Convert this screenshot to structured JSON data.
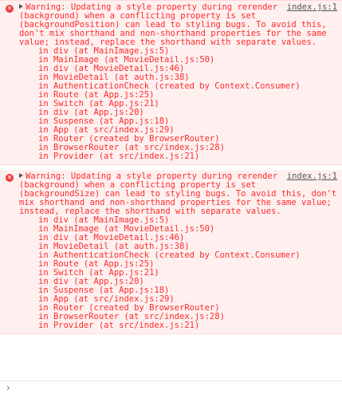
{
  "colors": {
    "error_text": "#fe2b2b",
    "error_bg": "#fff0f0",
    "error_icon": "#ee3c3c"
  },
  "icons": {
    "error": "error-circle-x-icon",
    "expand": "expand-triangle-icon",
    "prompt": "prompt-chevron-icon"
  },
  "entries": [
    {
      "source": "index.js:1",
      "message": "Warning: Updating a style property during rerender (background) when a conflicting property is set (backgroundPosition) can lead to styling bugs. To avoid this, don't mix shorthand and non-shorthand properties for the same value; instead, replace the shorthand with separate values.",
      "stack": [
        "in div (at MainImage.js:5)",
        "in MainImage (at MovieDetail.js:50)",
        "in div (at MovieDetail.js:46)",
        "in MovieDetail (at auth.js:38)",
        "in AuthenticationCheck (created by Context.Consumer)",
        "in Route (at App.js:25)",
        "in Switch (at App.js:21)",
        "in div (at App.js:20)",
        "in Suspense (at App.js:18)",
        "in App (at src/index.js:29)",
        "in Router (created by BrowserRouter)",
        "in BrowserRouter (at src/index.js:28)",
        "in Provider (at src/index.js:21)"
      ]
    },
    {
      "source": "index.js:1",
      "message": "Warning: Updating a style property during rerender (background) when a conflicting property is set (backgroundSize) can lead to styling bugs. To avoid this, don't mix shorthand and non-shorthand properties for the same value; instead, replace the shorthand with separate values.",
      "stack": [
        "in div (at MainImage.js:5)",
        "in MainImage (at MovieDetail.js:50)",
        "in div (at MovieDetail.js:46)",
        "in MovieDetail (at auth.js:38)",
        "in AuthenticationCheck (created by Context.Consumer)",
        "in Route (at App.js:25)",
        "in Switch (at App.js:21)",
        "in div (at App.js:20)",
        "in Suspense (at App.js:18)",
        "in App (at src/index.js:29)",
        "in Router (created by BrowserRouter)",
        "in BrowserRouter (at src/index.js:28)",
        "in Provider (at src/index.js:21)"
      ]
    }
  ],
  "prompt": {
    "symbol": "›"
  }
}
